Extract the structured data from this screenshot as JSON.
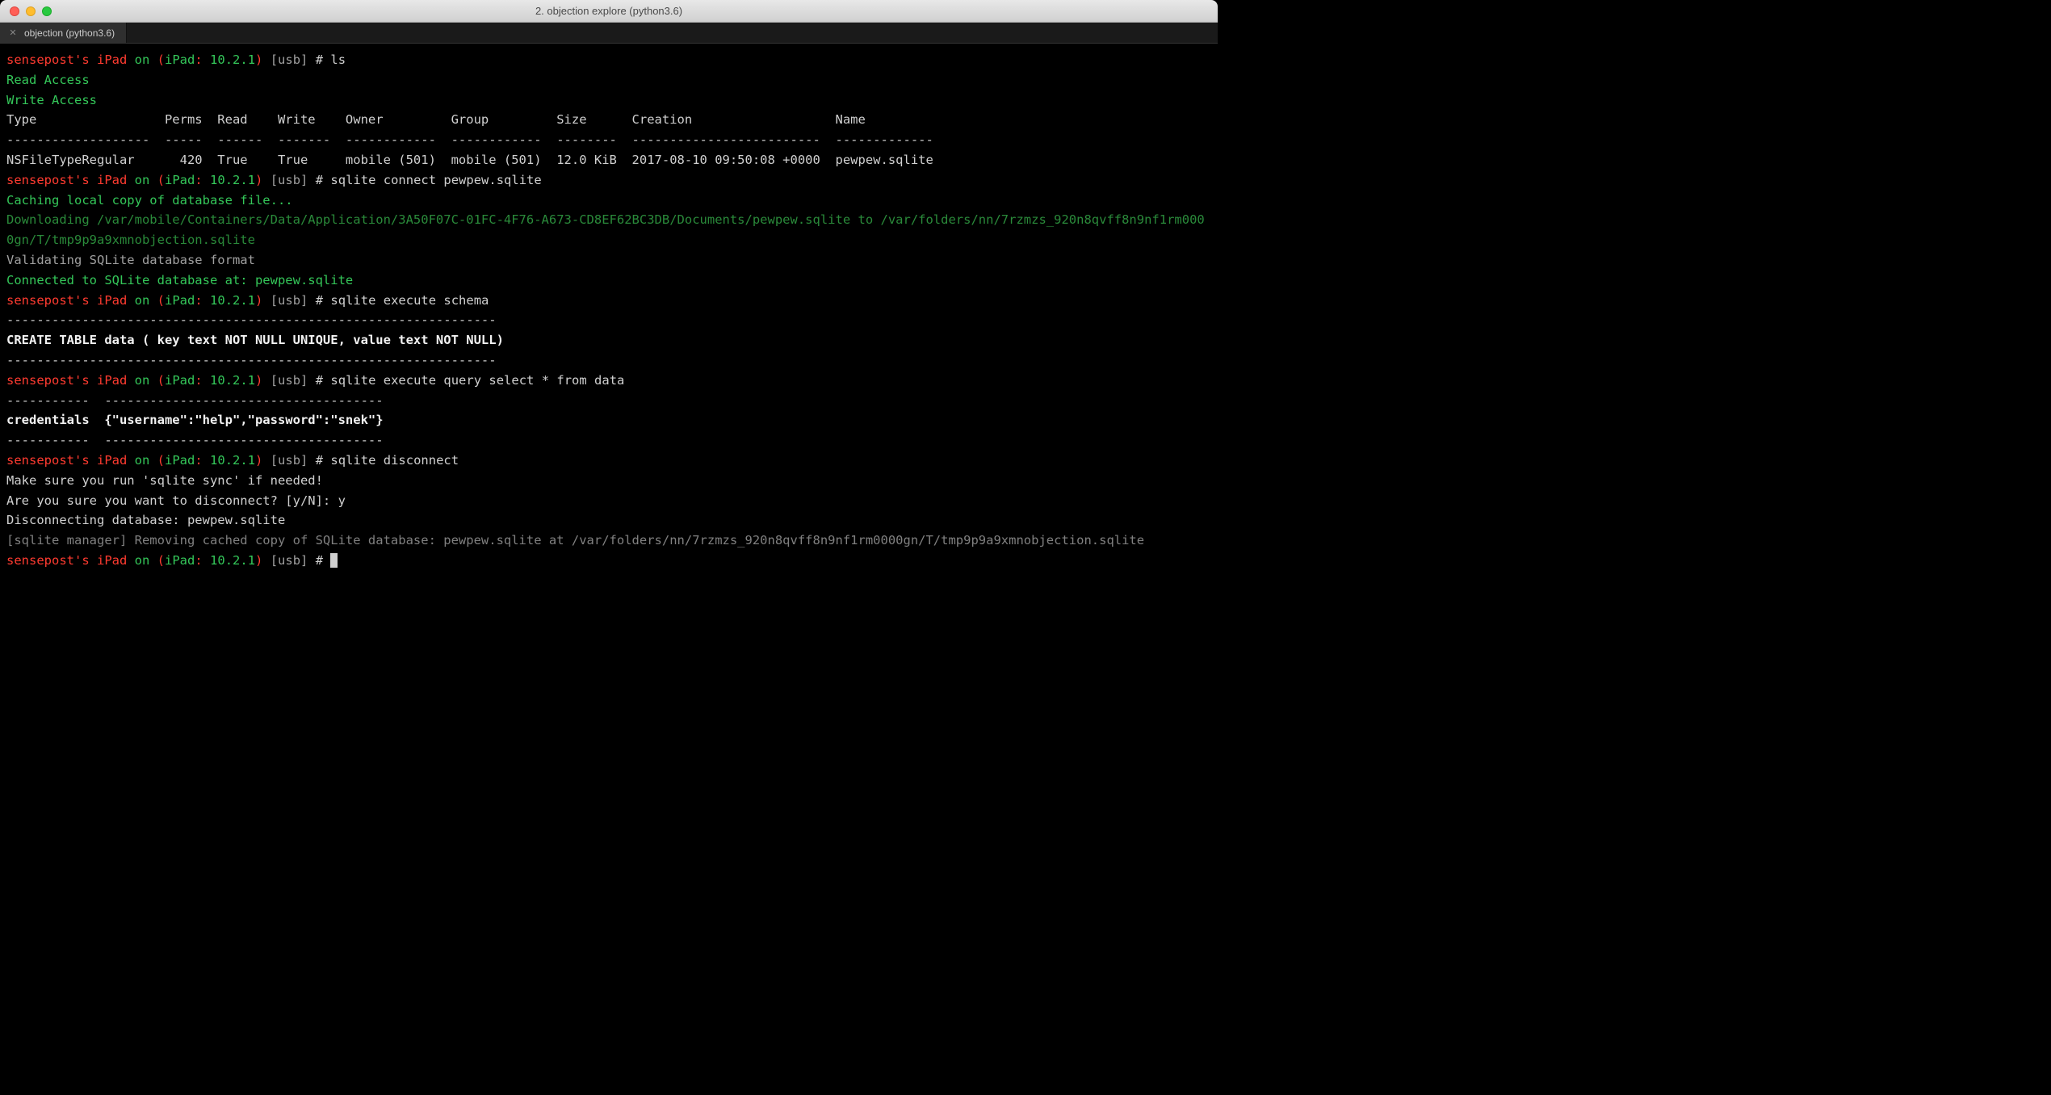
{
  "window": {
    "title": "2. objection explore (python3.6)",
    "tab_label": "objection (python3.6)"
  },
  "prompt": {
    "host": "sensepost's iPad",
    "on": "on",
    "device_open": "(",
    "device_name": "iPad",
    "device_sep": ":",
    "device_ver": "10.2.1",
    "device_close": ")",
    "conn": "[usb]",
    "hash": "#"
  },
  "commands": {
    "ls": "ls",
    "connect": "sqlite connect pewpew.sqlite",
    "schema": "sqlite execute schema",
    "query": "sqlite execute query select * from data",
    "disconnect": "sqlite disconnect"
  },
  "ls_output": {
    "read_access": "Read Access",
    "write_access": "Write Access",
    "header_line": "Type                 Perms  Read    Write    Owner         Group         Size      Creation                   Name",
    "divider_line": "-------------------  -----  ------  -------  ------------  ------------  --------  -------------------------  -------------",
    "row_line": "NSFileTypeRegular      420  True    True     mobile (501)  mobile (501)  12.0 KiB  2017-08-10 09:50:08 +0000  pewpew.sqlite"
  },
  "connect_output": {
    "caching": "Caching local copy of database file...",
    "downloading": "Downloading /var/mobile/Containers/Data/Application/3A50F07C-01FC-4F76-A673-CD8EF62BC3DB/Documents/pewpew.sqlite to /var/folders/nn/7rzmzs_920n8qvff8n9nf1rm0000gn/T/tmp9p9a9xmnobjection.sqlite",
    "validating": "Validating SQLite database format",
    "connected": "Connected to SQLite database at: pewpew.sqlite"
  },
  "schema_output": {
    "divider": "-----------------------------------------------------------------",
    "row": "CREATE TABLE data ( key text NOT NULL UNIQUE, value text NOT NULL)"
  },
  "query_output": {
    "divider": "-----------  -------------------------------------",
    "row": "credentials  {\"username\":\"help\",\"password\":\"snek\"}"
  },
  "disconnect_output": {
    "warn": "Make sure you run 'sqlite sync' if needed!",
    "confirm": "Are you sure you want to disconnect? [y/N]: y",
    "disc": "Disconnecting database: pewpew.sqlite",
    "removing": "[sqlite manager] Removing cached copy of SQLite database: pewpew.sqlite at /var/folders/nn/7rzmzs_920n8qvff8n9nf1rm0000gn/T/tmp9p9a9xmnobjection.sqlite"
  }
}
